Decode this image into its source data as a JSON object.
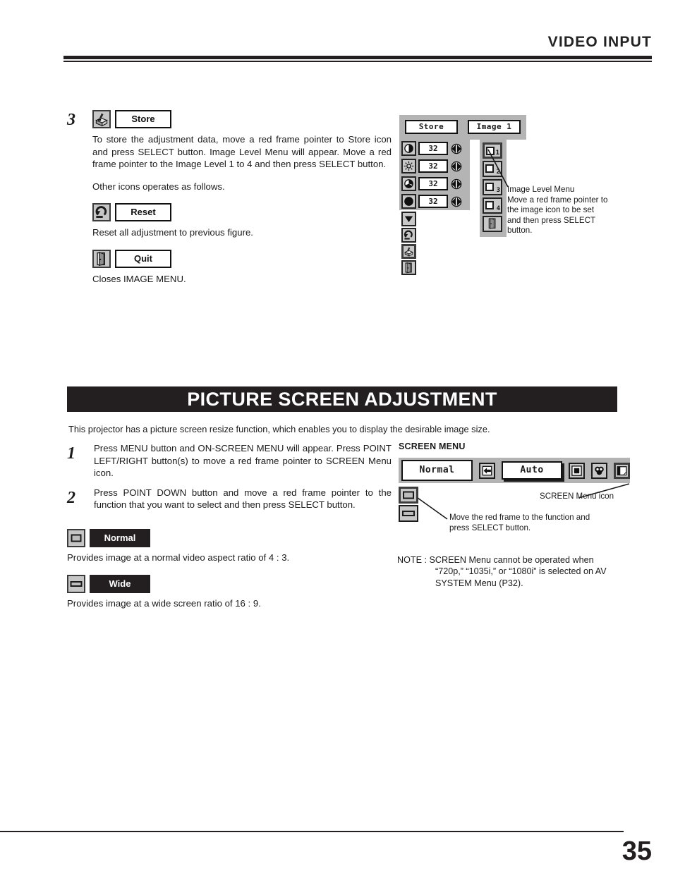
{
  "header": {
    "title": "VIDEO  INPUT"
  },
  "step3": {
    "number": "3",
    "store_label": "Store",
    "store_text": "To store the adjustment data, move a red frame pointer to Store icon and press SELECT button.  Image Level Menu will appear. Move a red frame pointer to the Image Level 1 to 4 and then press SELECT button.",
    "other_icons_text": "Other icons operates as follows.",
    "reset_label": "Reset",
    "reset_text": "Reset all adjustment to previous figure.",
    "quit_label": "Quit",
    "quit_text": "Closes IMAGE MENU."
  },
  "osd": {
    "head": {
      "store": "Store",
      "image": "Image 1"
    },
    "adjust_rows": [
      {
        "icon": "contrast-icon",
        "value": "32"
      },
      {
        "icon": "brightness-icon",
        "value": "32"
      },
      {
        "icon": "color-icon",
        "value": "32"
      },
      {
        "icon": "tint-icon",
        "value": "32"
      }
    ],
    "stack_icons": [
      "down-arrow-icon",
      "reset-icon",
      "store-icon",
      "quit-icon"
    ],
    "levels": [
      {
        "label": "1",
        "selected": true
      },
      {
        "label": "2",
        "selected": false
      },
      {
        "label": "3",
        "selected": false
      },
      {
        "label": "4",
        "selected": false
      }
    ],
    "level_quit_icon": "quit-icon",
    "callout": {
      "line1": "Image Level Menu",
      "line2": "Move a red frame pointer to",
      "line3": "the image icon to be set",
      "line4": "and then press SELECT",
      "line5": "button."
    }
  },
  "section": {
    "bar_title": "PICTURE SCREEN ADJUSTMENT",
    "intro": "This projector has a picture screen resize function, which enables you to display the desirable image size."
  },
  "steps": [
    {
      "number": "1",
      "text": "Press MENU button and ON-SCREEN MENU will appear.  Press POINT LEFT/RIGHT button(s) to move a red frame pointer to SCREEN Menu icon."
    },
    {
      "number": "2",
      "text": "Press POINT DOWN button and move a red frame pointer to the function that you want to select and then press SELECT button."
    }
  ],
  "modes": [
    {
      "label": "Normal",
      "text": "Provides image at a normal video aspect ratio of 4 : 3."
    },
    {
      "label": "Wide",
      "text": "Provides image at a wide screen ratio of 16 : 9."
    }
  ],
  "screen_menu": {
    "title": "SCREEN MENU",
    "normal_value": "Normal",
    "auto_value": "Auto",
    "icons": [
      "input-icon",
      "image-icon",
      "color-wheel-icon",
      "screen-menu-icon"
    ],
    "callout_icon": "SCREEN Menu icon",
    "callout_move_line1": "Move the red frame to the function and",
    "callout_move_line2": "press SELECT button."
  },
  "note": {
    "label": "NOTE :",
    "line1": "SCREEN Menu cannot be operated when",
    "line2": "“720p,” “1035i,” or “1080i” is selected on AV",
    "line3": "SYSTEM Menu (P32)."
  },
  "footer": {
    "page_number": "35"
  }
}
